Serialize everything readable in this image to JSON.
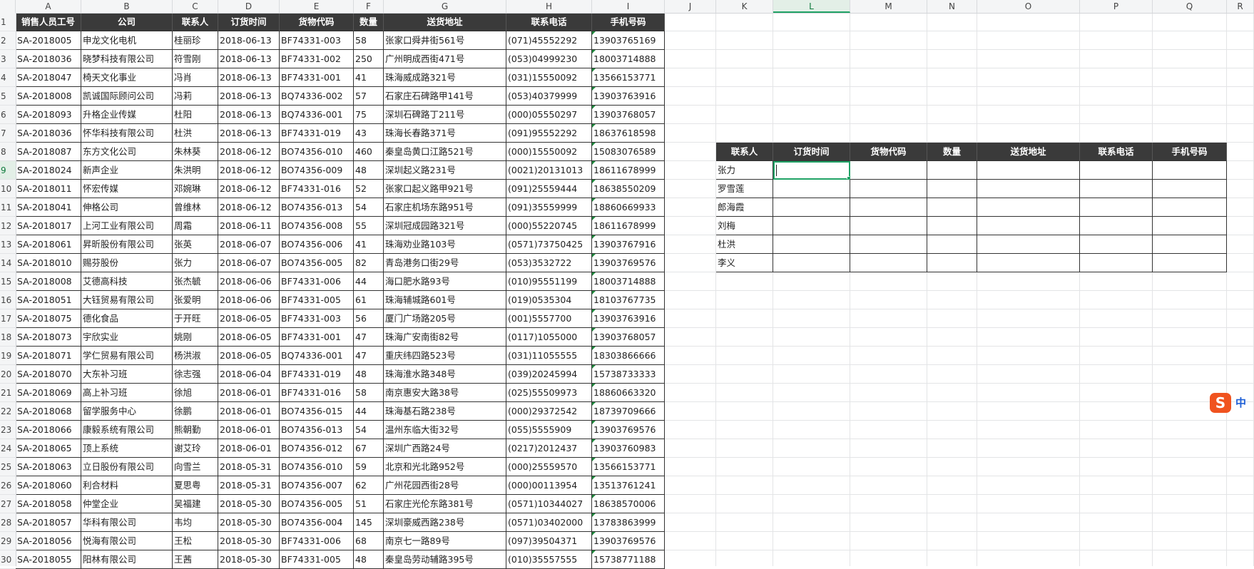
{
  "columns": [
    "A",
    "B",
    "C",
    "D",
    "E",
    "F",
    "G",
    "H",
    "I",
    "J",
    "K",
    "L",
    "M",
    "N",
    "O",
    "P",
    "Q",
    "R"
  ],
  "selected_column": "L",
  "rows": [
    "1",
    "2",
    "3",
    "4",
    "5",
    "6",
    "7",
    "8",
    "9",
    "10",
    "11",
    "12",
    "13",
    "14",
    "15",
    "16",
    "17",
    "18",
    "19",
    "20",
    "21",
    "22",
    "23",
    "24",
    "25",
    "26",
    "27",
    "28",
    "29",
    "30"
  ],
  "selected_row": "9",
  "main_table": {
    "headers": [
      "销售人员工号",
      "公司",
      "联系人",
      "订货时间",
      "货物代码",
      "数量",
      "送货地址",
      "联系电话",
      "手机号码"
    ],
    "rows": [
      [
        "SA-2018005",
        "申龙文化电机",
        "桂丽珍",
        "2018-06-13",
        "BF74331-003",
        "58",
        "张家口舜井街561号",
        "(071)45552292",
        "13903765169"
      ],
      [
        "SA-2018036",
        "晓梦科技有限公司",
        "符雪刚",
        "2018-06-13",
        "BF74331-002",
        "250",
        "广州明成西街471号",
        "(053)04999230",
        "18003714888"
      ],
      [
        "SA-2018047",
        "椅天文化事业",
        "冯肖",
        "2018-06-13",
        "BF74331-001",
        "41",
        "珠海威成路321号",
        "(031)15550092",
        "13566153771"
      ],
      [
        "SA-2018008",
        "凯诚国际顾问公司",
        "冯莉",
        "2018-06-13",
        "BQ74336-002",
        "57",
        "石家庄石碑路甲141号",
        "(053)40379999",
        "13903763916"
      ],
      [
        "SA-2018093",
        "升格企业传媒",
        "杜阳",
        "2018-06-13",
        "BQ74336-001",
        "75",
        "深圳石碑路丁211号",
        "(000)05550297",
        "13903768057"
      ],
      [
        "SA-2018036",
        "怀华科技有限公司",
        "杜洪",
        "2018-06-13",
        "BF74331-019",
        "43",
        "珠海长春路371号",
        "(091)95552292",
        "18637618598"
      ],
      [
        "SA-2018087",
        "东方文化公司",
        "朱林葵",
        "2018-06-12",
        "BO74356-010",
        "460",
        "秦皇岛黄口江路521号",
        "(000)15550092",
        "15083076589"
      ],
      [
        "SA-2018024",
        "新声企业",
        "朱洪明",
        "2018-06-12",
        "BO74356-009",
        "48",
        "深圳起义路231号",
        "(0021)20131013",
        "18611678999"
      ],
      [
        "SA-2018011",
        "怀宏传媒",
        "邓婉琳",
        "2018-06-12",
        "BF74331-016",
        "52",
        "张家口起义路甲921号",
        "(091)25559444",
        "18638550209"
      ],
      [
        "SA-2018041",
        "伸格公司",
        "曾维林",
        "2018-06-12",
        "BO74356-013",
        "54",
        "石家庄机场东路951号",
        "(091)35559999",
        "18860669933"
      ],
      [
        "SA-2018017",
        "上河工业有限公司",
        "周霜",
        "2018-06-11",
        "BO74356-008",
        "55",
        "深圳冠成园路321号",
        "(000)55220745",
        "18611678999"
      ],
      [
        "SA-2018061",
        "昇昕股份有限公司",
        "张英",
        "2018-06-07",
        "BO74356-006",
        "41",
        "珠海劝业路103号",
        "(0571)73750425",
        "13903767916"
      ],
      [
        "SA-2018010",
        "赐芬股份",
        "张力",
        "2018-06-07",
        "BO74356-005",
        "82",
        "青岛港务口街29号",
        "(053)3532722",
        "13903769576"
      ],
      [
        "SA-2018008",
        "艾德高科技",
        "张杰毓",
        "2018-06-06",
        "BF74331-006",
        "44",
        "海口肥水路93号",
        "(010)95551199",
        "18003714888"
      ],
      [
        "SA-2018051",
        "大钰贸易有限公司",
        "张爱明",
        "2018-06-06",
        "BF74331-005",
        "61",
        "珠海辅城路601号",
        "(019)0535304",
        "18103767735"
      ],
      [
        "SA-2018075",
        "德化食品",
        "于开旺",
        "2018-06-05",
        "BF74331-003",
        "56",
        "厦门广场路205号",
        "(001)5557700",
        "13903763916"
      ],
      [
        "SA-2018073",
        "宇欣实业",
        "姚刚",
        "2018-06-05",
        "BF74331-001",
        "47",
        "珠海广安南街82号",
        "(0117)1055000",
        "13903768057"
      ],
      [
        "SA-2018071",
        "学仁贸易有限公司",
        "杨洪淑",
        "2018-06-05",
        "BQ74336-001",
        "47",
        "重庆纬四路523号",
        "(031)11055555",
        "18303866666"
      ],
      [
        "SA-2018070",
        "大东补习班",
        "徐志强",
        "2018-06-04",
        "BF74331-019",
        "48",
        "珠海淮水路348号",
        "(039)20245994",
        "15738733333"
      ],
      [
        "SA-2018069",
        "高上补习班",
        "徐旭",
        "2018-06-01",
        "BF74331-016",
        "58",
        "南京惠安大路38号",
        "(025)55509973",
        "18860663320"
      ],
      [
        "SA-2018068",
        "留学服务中心",
        "徐鹏",
        "2018-06-01",
        "BO74356-015",
        "44",
        "珠海基石路238号",
        "(000)29372542",
        "18739709666"
      ],
      [
        "SA-2018066",
        "康毅系统有限公司",
        "熊朝勤",
        "2018-06-01",
        "BO74356-013",
        "54",
        "温州东临大街32号",
        "(055)5555909",
        "13903769576"
      ],
      [
        "SA-2018065",
        "顶上系统",
        "谢艾玲",
        "2018-06-01",
        "BO74356-012",
        "67",
        "深圳广西路24号",
        "(0217)2012437",
        "13903760983"
      ],
      [
        "SA-2018063",
        "立日股份有限公司",
        "向雪兰",
        "2018-05-31",
        "BO74356-010",
        "59",
        "北京和光北路952号",
        "(000)25559570",
        "13566153771"
      ],
      [
        "SA-2018060",
        "利合材料",
        "夏思粤",
        "2018-05-31",
        "BO74356-007",
        "62",
        "广州花园西街28号",
        "(000)00113954",
        "13513761241"
      ],
      [
        "SA-2018058",
        "仲堂企业",
        "吴福建",
        "2018-05-30",
        "BO74356-005",
        "51",
        "石家庄光伦东路381号",
        "(0571)10344027",
        "18638570006"
      ],
      [
        "SA-2018057",
        "华科有限公司",
        "韦均",
        "2018-05-30",
        "BO74356-004",
        "145",
        "深圳豪威西路238号",
        "(0571)03402000",
        "13783863999"
      ],
      [
        "SA-2018056",
        "悦海有限公司",
        "王松",
        "2018-05-30",
        "BF74331-006",
        "68",
        "南京七一路89号",
        "(097)39504371",
        "13903769576"
      ],
      [
        "SA-2018055",
        "阳林有限公司",
        "王茜",
        "2018-05-30",
        "BF74331-005",
        "48",
        "秦皇岛劳动辅路395号",
        "(010)35557555",
        "15738771188"
      ]
    ]
  },
  "lookup_table": {
    "headers": [
      "联系人",
      "订货时间",
      "货物代码",
      "数量",
      "送货地址",
      "联系电话",
      "手机号码"
    ],
    "names": [
      "张力",
      "罗雪莲",
      "郎海霞",
      "刘梅",
      "杜洪",
      "李义"
    ]
  },
  "ime": {
    "logo": "S",
    "mode": "中"
  },
  "colors": {
    "header_bg": "#3a3a3a",
    "accent": "#21a366",
    "ime": "#f0531f"
  }
}
